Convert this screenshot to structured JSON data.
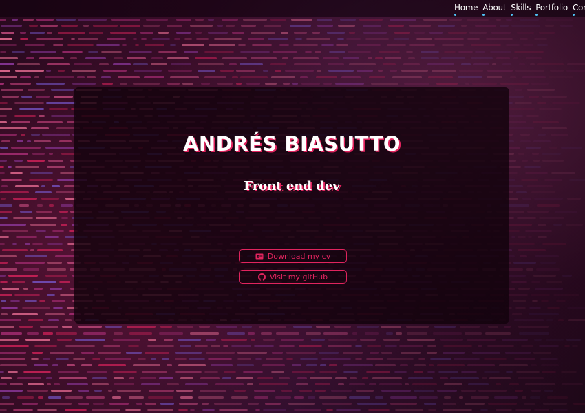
{
  "nav": {
    "items": [
      {
        "label": "Home"
      },
      {
        "label": "About"
      },
      {
        "label": "Skills"
      },
      {
        "label": "Portfolio"
      },
      {
        "label": "Contact"
      }
    ]
  },
  "hero": {
    "name": "ANDRÉS BIASUTTO",
    "role": "Front end dev",
    "buttons": {
      "download_cv": {
        "label": "Download my cv",
        "icon": "id-card-icon"
      },
      "github": {
        "label": "Visit my gitHub",
        "icon": "github-icon"
      }
    }
  },
  "colors": {
    "accent": "#e0245e",
    "nav_dot": "#4fc3f7",
    "card_bg": "rgba(18,2,12,0.82)"
  }
}
